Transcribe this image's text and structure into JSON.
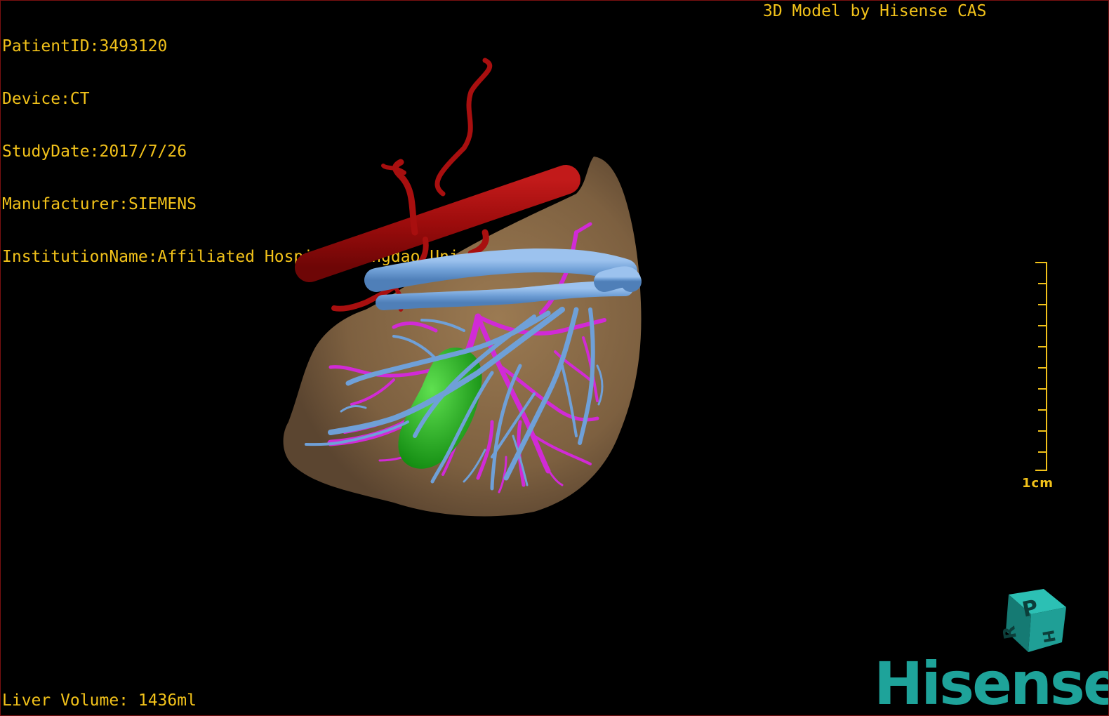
{
  "study": {
    "patient_id": "PatientID:3493120",
    "device": "Device:CT",
    "study_date": "StudyDate:2017/7/26",
    "manufacturer": "Manufacturer:SIEMENS",
    "institution": "InstitutionName:Affiliated Hospital Qingdao University-C"
  },
  "model_credit": "3D Model by Hisense CAS",
  "liver_volume": "Liver Volume: 1436ml",
  "scale_bar": {
    "label": "1cm"
  },
  "orientation_cube": {
    "faces": [
      "P",
      "H",
      "R"
    ]
  },
  "brand": {
    "logo_text": "Hisense"
  },
  "colors": {
    "overlay_text": "#f2c21a",
    "liver": "#8a6b47",
    "artery": "#a80f0f",
    "portal_vein": "#d12ad6",
    "hepatic_vein": "#6fa0d8",
    "gallbladder": "#1fb51a",
    "brand": "#1ea39a",
    "frame": "#7a1010"
  },
  "icons": {
    "orientation_cube": "orientation-cube-icon",
    "scale_bar": "scale-ruler-icon"
  }
}
